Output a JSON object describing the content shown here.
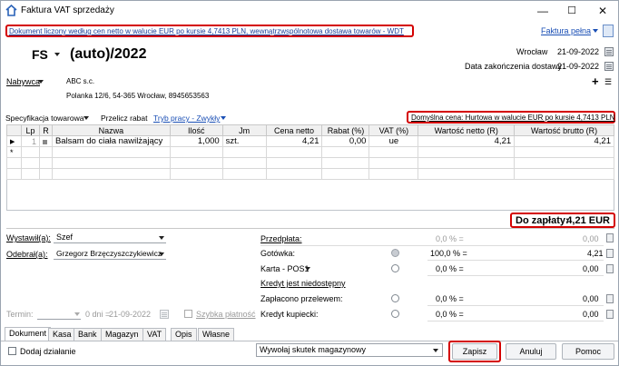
{
  "window": {
    "title": "Faktura VAT sprzedaży",
    "min": "—",
    "max": "☐",
    "close": "✕"
  },
  "top": {
    "info_banner": "Dokument liczony według cen netto w walucie EUR po kursie 4,7413 PLN, wewnątrzwspólnotowa dostawa towarów - WDT",
    "faktura_link": "Faktura pełna"
  },
  "doc": {
    "series": "FS",
    "number": "(auto)/2022",
    "place_label": "Wrocław",
    "place_date": "21-09-2022",
    "delivery_label": "Data zakończenia dostawy",
    "delivery_date": "21-09-2022"
  },
  "buyer": {
    "label": "Nabywca",
    "name": "ABC s.c.",
    "address": "Polanka  12/6, 54-365 Wrocław, 8945653563"
  },
  "toolbar2": {
    "spec": "Specyfikacja towarowa",
    "discount": "Przelicz rabat",
    "mode": "Tryb pracy - Zwykły",
    "default_price": "Domyślna cena: Hurtowa w walucie EUR po kursie 4,7413 PLN"
  },
  "table": {
    "headers": [
      "Lp",
      "R",
      "Nazwa",
      "Ilość",
      "Jm",
      "Cena netto",
      "Rabat (%)",
      "VAT (%)",
      "Wartość netto (R)",
      "Wartość brutto (R)"
    ],
    "row": {
      "lp": "1",
      "name": "Balsam do ciała nawilżający",
      "qty": "1,000",
      "unit": "szt.",
      "price": "4,21",
      "discount": "0,00",
      "vat": "ue",
      "net": "4,21",
      "gross": "4,21"
    },
    "new_row_marker": "*",
    "row_marker": "▶"
  },
  "total": {
    "label": "Do zapłaty:",
    "value": "4,21 EUR"
  },
  "people": {
    "issued_label": "Wystawił(a):",
    "issued_value": "Szef",
    "received_label": "Odebrał(a):",
    "received_value": "Grzegorz Brzęczyszczykiewicz"
  },
  "payments": {
    "prepayment": "Przedpłata:",
    "prepayment_pct": "0,0 % =",
    "prepayment_val": "0,00",
    "cash": "Gotówka:",
    "cash_pct": "100,0 % =",
    "cash_val": "4,21",
    "card": "Karta - POS1",
    "card_pct": "0,0 % =",
    "card_val": "0,00",
    "credit": "Kredyt jest niedostępny",
    "transfer": "Zapłacono przelewem:",
    "transfer_pct": "0,0 % =",
    "transfer_val": "0,00",
    "merchant": "Kredyt kupiecki:",
    "merchant_pct": "0,0 % =",
    "merchant_val": "0,00"
  },
  "term": {
    "label": "Termin:",
    "days": "0 dni =",
    "date": "21-09-2022",
    "quick": "Szybka płatność"
  },
  "tabs": [
    "Dokument",
    "Kasa",
    "Bank",
    "Magazyn",
    "VAT",
    "Opis",
    "Własne"
  ],
  "bottom": {
    "add_action": "Dodaj działanie",
    "warehouse": "Wywołaj skutek magazynowy",
    "save": "Zapisz",
    "cancel": "Anuluj",
    "help": "Pomoc"
  }
}
